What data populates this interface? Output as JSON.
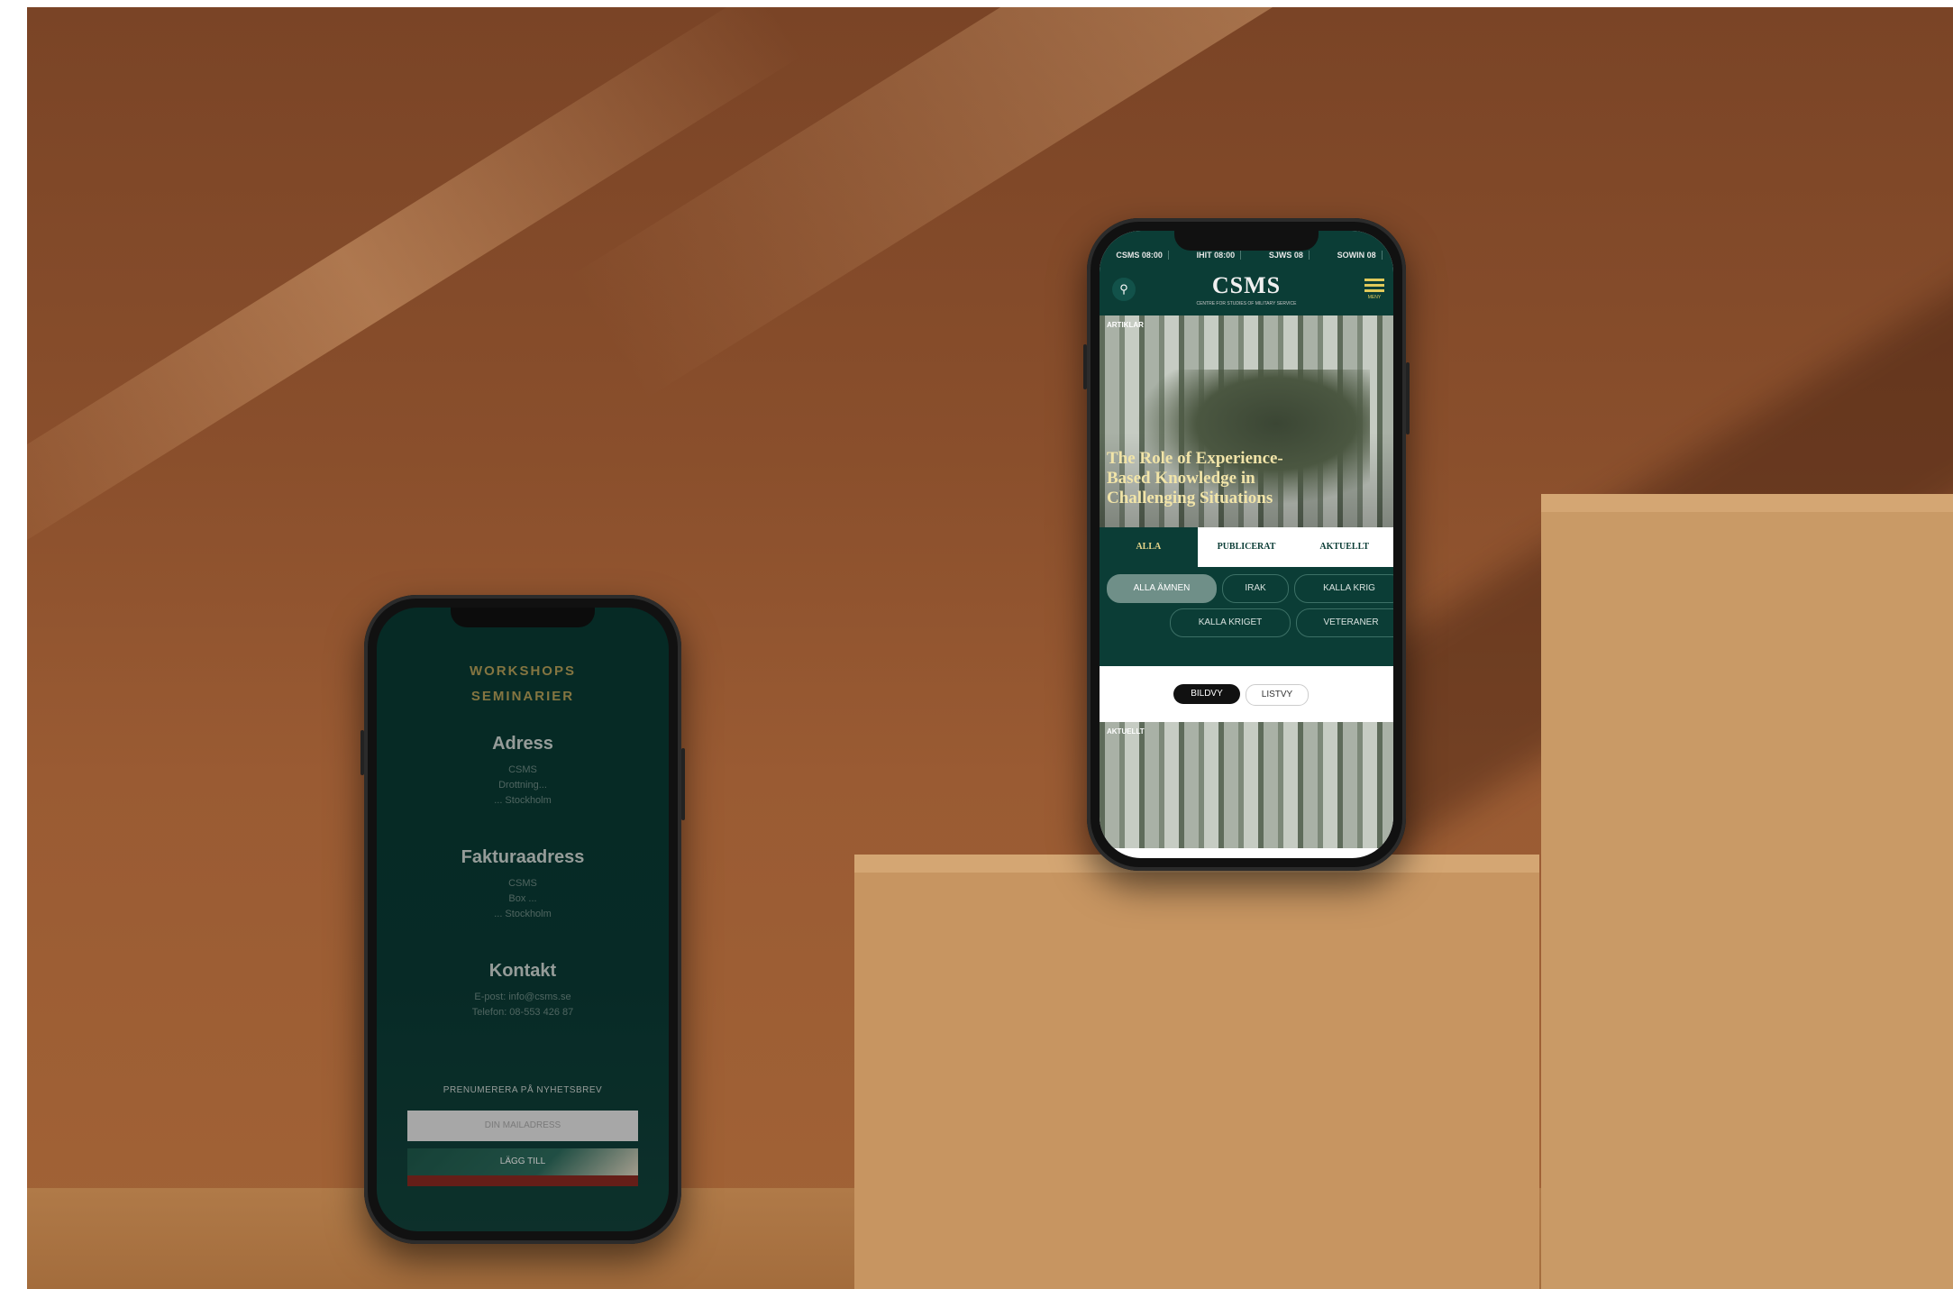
{
  "left_phone": {
    "nav_items": [
      "WORKSHOPS",
      "SEMINARIER"
    ],
    "address": {
      "heading": "Adress",
      "lines": [
        "CSMS",
        "Drottning...",
        "...  Stockholm"
      ]
    },
    "invoice": {
      "heading": "Fakturaadress",
      "lines": [
        "CSMS",
        "Box ...",
        "...  Stockholm"
      ]
    },
    "contact": {
      "heading": "Kontakt",
      "lines": [
        "E-post: info@csms.se",
        "Telefon: 08-553 426 87"
      ]
    },
    "newsletter": {
      "label": "PRENUMERERA PÅ NYHETSBREV",
      "placeholder": "DIN MAILADRESS",
      "button": "LÄGG TILL"
    }
  },
  "right_phone": {
    "status_items": [
      "CSMS 08:00",
      "IHIT 08:00",
      "SJWS 08",
      "SOWIN 08"
    ],
    "logo": "CSMS",
    "logo_sub": "CENTRE FOR STUDIES OF MILITARY SERVICE",
    "menu_label": "MENY",
    "hero": {
      "label": "ARTIKLAR",
      "title": "The Role of Experience-Based Knowledge in Challenging Situations"
    },
    "tabs": [
      "ALLA",
      "PUBLICERAT",
      "AKTUELLT"
    ],
    "filters": [
      "ALLA ÄMNEN",
      "IRAK",
      "KALLA KRIG",
      "KALLA KRIGET",
      "VETERANER"
    ],
    "views": [
      "BILDVY",
      "LISTVY"
    ],
    "card_label": "AKTUELLT"
  },
  "colors": {
    "brand_green": "#0b3d36",
    "gold": "#e0c95a",
    "backdrop": "#9a5b33"
  }
}
